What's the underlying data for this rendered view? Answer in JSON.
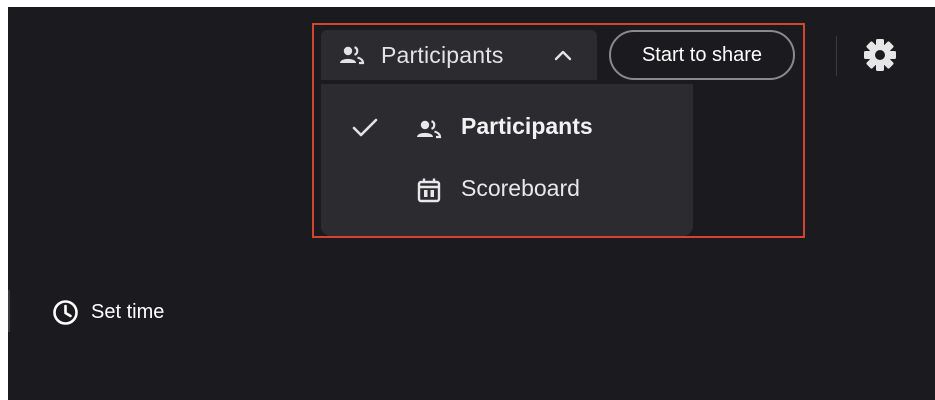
{
  "view_select": {
    "selected_label": "Participants",
    "selected_icon": "people-icon",
    "expanded": true
  },
  "share_button": {
    "label": "Start to share"
  },
  "settings": {
    "icon": "gear-icon"
  },
  "menu": {
    "items": [
      {
        "label": "Participants",
        "icon": "people-icon",
        "selected": true
      },
      {
        "label": "Scoreboard",
        "icon": "calendar-icon",
        "selected": false
      }
    ]
  },
  "timer": {
    "label": "Set time",
    "icon": "clock-icon"
  },
  "colors": {
    "background": "#1b1b1f",
    "surface": "#2b2b30",
    "highlight_border": "#d2462f",
    "text": "#e3e3e3"
  }
}
